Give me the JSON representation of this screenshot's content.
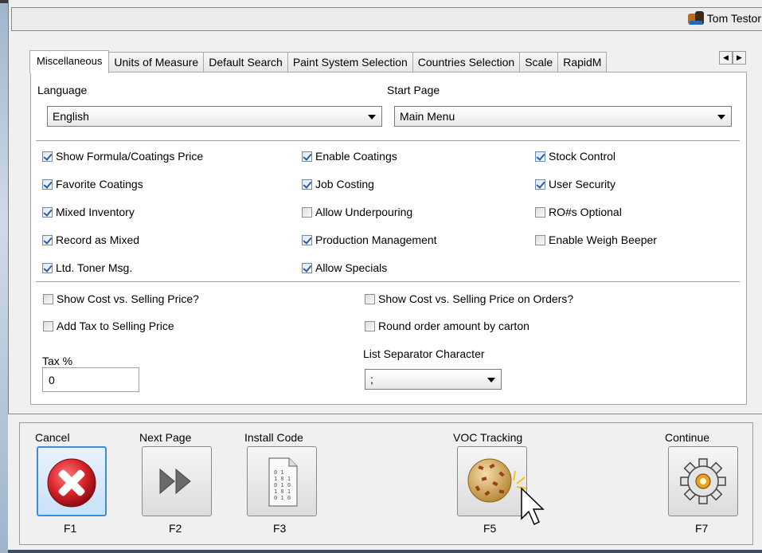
{
  "user": {
    "name": "Tom Testor"
  },
  "tabs": [
    "Miscellaneous",
    "Units of Measure",
    "Default Search",
    "Paint System Selection",
    "Countries Selection",
    "Scale",
    "RapidM"
  ],
  "language": {
    "label": "Language",
    "value": "English"
  },
  "start_page": {
    "label": "Start Page",
    "value": "Main Menu"
  },
  "checks": {
    "col1": [
      {
        "label": "Show Formula/Coatings Price",
        "checked": true
      },
      {
        "label": "Favorite Coatings",
        "checked": true
      },
      {
        "label": "Mixed Inventory",
        "checked": true
      },
      {
        "label": "Record as Mixed",
        "checked": true
      },
      {
        "label": "Ltd. Toner Msg.",
        "checked": true
      }
    ],
    "col2": [
      {
        "label": "Enable Coatings",
        "checked": true
      },
      {
        "label": "Job Costing",
        "checked": true
      },
      {
        "label": "Allow Underpouring",
        "checked": false
      },
      {
        "label": "Production Management",
        "checked": true
      },
      {
        "label": "Allow Specials",
        "checked": true
      }
    ],
    "col3": [
      {
        "label": "Stock Control",
        "checked": true
      },
      {
        "label": "User Security",
        "checked": true
      },
      {
        "label": "RO#s Optional",
        "checked": false
      },
      {
        "label": "Enable Weigh Beeper",
        "checked": false
      }
    ]
  },
  "options": {
    "show_cost": "Show Cost vs. Selling Price?",
    "add_tax": "Add Tax to Selling Price",
    "show_cost_orders": "Show Cost vs. Selling Price on Orders?",
    "round_order": "Round order amount by carton"
  },
  "tax": {
    "label": "Tax %",
    "value": "0"
  },
  "list_separator": {
    "label": "List Separator Character",
    "value": ";"
  },
  "buttons": [
    {
      "caption": "Cancel",
      "key": "F1"
    },
    {
      "caption": "Next Page",
      "key": "F2"
    },
    {
      "caption": "Install Code",
      "key": "F3"
    },
    {
      "caption": "VOC Tracking",
      "key": "F5"
    },
    {
      "caption": "Continue",
      "key": "F7"
    }
  ],
  "icons": {
    "cancel": "cancel-x-icon",
    "next": "double-arrow-icon",
    "install": "binary-document-icon",
    "voc": "voc-cookie-icon",
    "continue": "gear-icon",
    "user": "user-avatar-icon"
  },
  "colors": {
    "cancel_red": "#d8232a",
    "selected_border": "#3c8de0"
  }
}
